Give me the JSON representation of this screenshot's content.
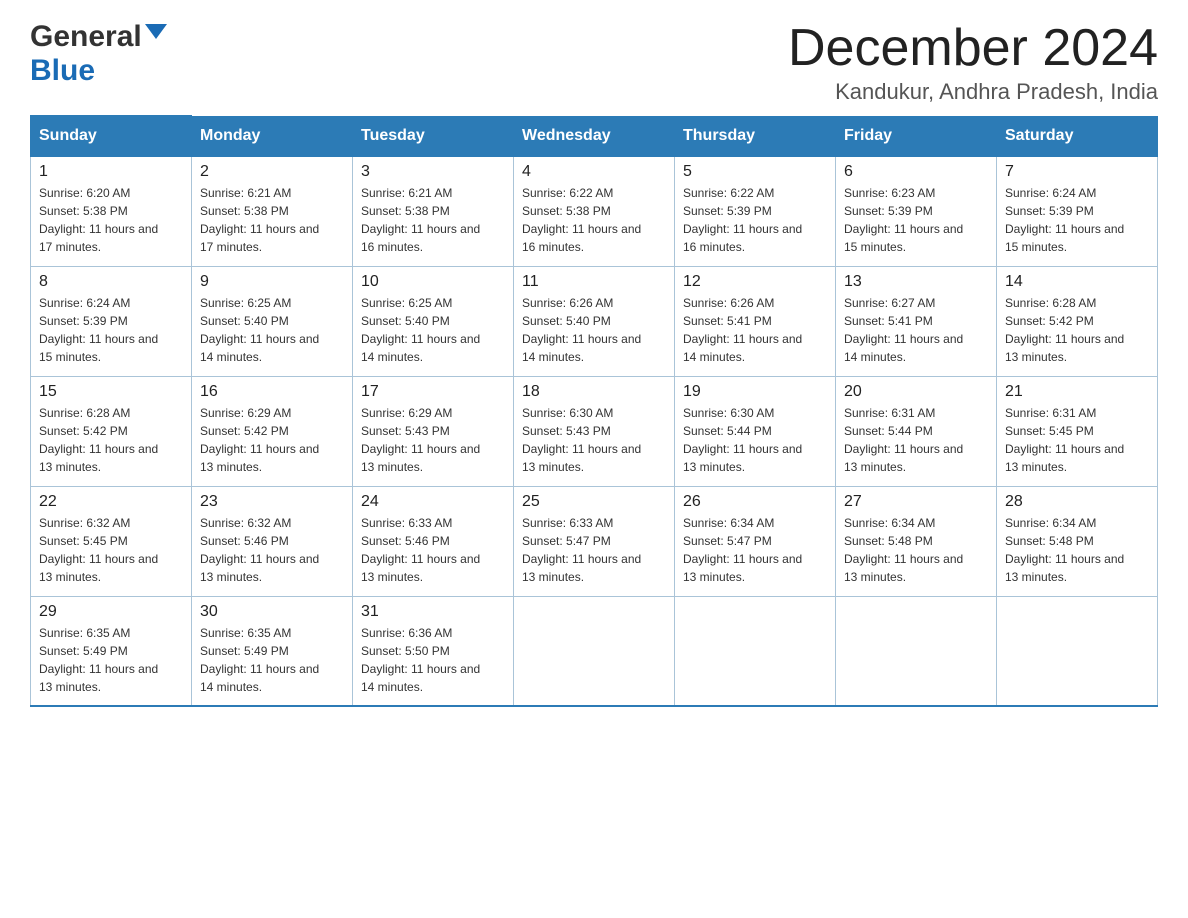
{
  "header": {
    "logo_general": "General",
    "logo_blue": "Blue",
    "month_title": "December 2024",
    "location": "Kandukur, Andhra Pradesh, India"
  },
  "days_of_week": [
    "Sunday",
    "Monday",
    "Tuesday",
    "Wednesday",
    "Thursday",
    "Friday",
    "Saturday"
  ],
  "weeks": [
    [
      {
        "day": "1",
        "sunrise": "6:20 AM",
        "sunset": "5:38 PM",
        "daylight": "11 hours and 17 minutes."
      },
      {
        "day": "2",
        "sunrise": "6:21 AM",
        "sunset": "5:38 PM",
        "daylight": "11 hours and 17 minutes."
      },
      {
        "day": "3",
        "sunrise": "6:21 AM",
        "sunset": "5:38 PM",
        "daylight": "11 hours and 16 minutes."
      },
      {
        "day": "4",
        "sunrise": "6:22 AM",
        "sunset": "5:38 PM",
        "daylight": "11 hours and 16 minutes."
      },
      {
        "day": "5",
        "sunrise": "6:22 AM",
        "sunset": "5:39 PM",
        "daylight": "11 hours and 16 minutes."
      },
      {
        "day": "6",
        "sunrise": "6:23 AM",
        "sunset": "5:39 PM",
        "daylight": "11 hours and 15 minutes."
      },
      {
        "day": "7",
        "sunrise": "6:24 AM",
        "sunset": "5:39 PM",
        "daylight": "11 hours and 15 minutes."
      }
    ],
    [
      {
        "day": "8",
        "sunrise": "6:24 AM",
        "sunset": "5:39 PM",
        "daylight": "11 hours and 15 minutes."
      },
      {
        "day": "9",
        "sunrise": "6:25 AM",
        "sunset": "5:40 PM",
        "daylight": "11 hours and 14 minutes."
      },
      {
        "day": "10",
        "sunrise": "6:25 AM",
        "sunset": "5:40 PM",
        "daylight": "11 hours and 14 minutes."
      },
      {
        "day": "11",
        "sunrise": "6:26 AM",
        "sunset": "5:40 PM",
        "daylight": "11 hours and 14 minutes."
      },
      {
        "day": "12",
        "sunrise": "6:26 AM",
        "sunset": "5:41 PM",
        "daylight": "11 hours and 14 minutes."
      },
      {
        "day": "13",
        "sunrise": "6:27 AM",
        "sunset": "5:41 PM",
        "daylight": "11 hours and 14 minutes."
      },
      {
        "day": "14",
        "sunrise": "6:28 AM",
        "sunset": "5:42 PM",
        "daylight": "11 hours and 13 minutes."
      }
    ],
    [
      {
        "day": "15",
        "sunrise": "6:28 AM",
        "sunset": "5:42 PM",
        "daylight": "11 hours and 13 minutes."
      },
      {
        "day": "16",
        "sunrise": "6:29 AM",
        "sunset": "5:42 PM",
        "daylight": "11 hours and 13 minutes."
      },
      {
        "day": "17",
        "sunrise": "6:29 AM",
        "sunset": "5:43 PM",
        "daylight": "11 hours and 13 minutes."
      },
      {
        "day": "18",
        "sunrise": "6:30 AM",
        "sunset": "5:43 PM",
        "daylight": "11 hours and 13 minutes."
      },
      {
        "day": "19",
        "sunrise": "6:30 AM",
        "sunset": "5:44 PM",
        "daylight": "11 hours and 13 minutes."
      },
      {
        "day": "20",
        "sunrise": "6:31 AM",
        "sunset": "5:44 PM",
        "daylight": "11 hours and 13 minutes."
      },
      {
        "day": "21",
        "sunrise": "6:31 AM",
        "sunset": "5:45 PM",
        "daylight": "11 hours and 13 minutes."
      }
    ],
    [
      {
        "day": "22",
        "sunrise": "6:32 AM",
        "sunset": "5:45 PM",
        "daylight": "11 hours and 13 minutes."
      },
      {
        "day": "23",
        "sunrise": "6:32 AM",
        "sunset": "5:46 PM",
        "daylight": "11 hours and 13 minutes."
      },
      {
        "day": "24",
        "sunrise": "6:33 AM",
        "sunset": "5:46 PM",
        "daylight": "11 hours and 13 minutes."
      },
      {
        "day": "25",
        "sunrise": "6:33 AM",
        "sunset": "5:47 PM",
        "daylight": "11 hours and 13 minutes."
      },
      {
        "day": "26",
        "sunrise": "6:34 AM",
        "sunset": "5:47 PM",
        "daylight": "11 hours and 13 minutes."
      },
      {
        "day": "27",
        "sunrise": "6:34 AM",
        "sunset": "5:48 PM",
        "daylight": "11 hours and 13 minutes."
      },
      {
        "day": "28",
        "sunrise": "6:34 AM",
        "sunset": "5:48 PM",
        "daylight": "11 hours and 13 minutes."
      }
    ],
    [
      {
        "day": "29",
        "sunrise": "6:35 AM",
        "sunset": "5:49 PM",
        "daylight": "11 hours and 13 minutes."
      },
      {
        "day": "30",
        "sunrise": "6:35 AM",
        "sunset": "5:49 PM",
        "daylight": "11 hours and 14 minutes."
      },
      {
        "day": "31",
        "sunrise": "6:36 AM",
        "sunset": "5:50 PM",
        "daylight": "11 hours and 14 minutes."
      },
      null,
      null,
      null,
      null
    ]
  ]
}
